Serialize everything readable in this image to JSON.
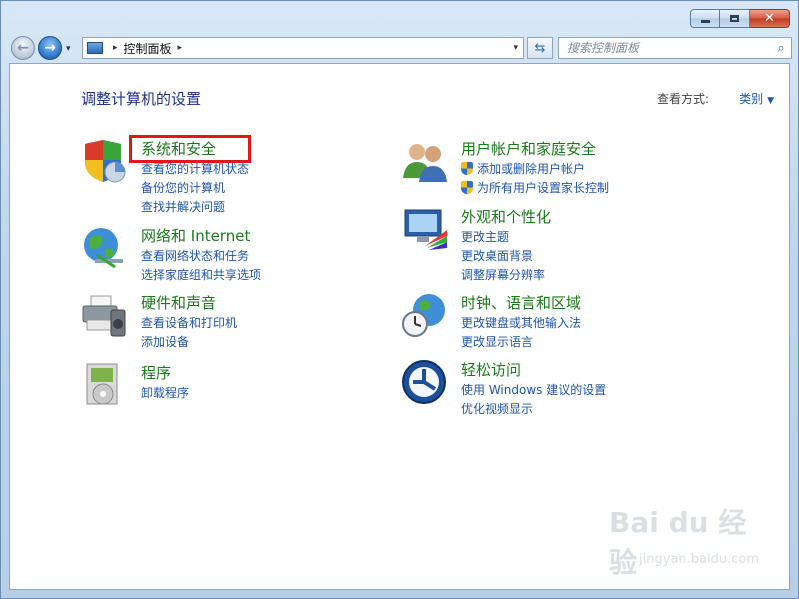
{
  "window": {
    "caption": {
      "minimize": "",
      "maximize": "",
      "close": "✕"
    }
  },
  "nav": {
    "back_icon": "←",
    "forward_icon": "→"
  },
  "address": {
    "separator_before": "▸",
    "path": "控制面板",
    "separator_after": "▸",
    "dropdown": "▾"
  },
  "search": {
    "placeholder": "搜索控制面板"
  },
  "header": {
    "title": "调整计算机的设置",
    "view_by_label": "查看方式:",
    "view_by_value": "类别"
  },
  "categories": {
    "left": [
      {
        "title": "系统和安全",
        "links": [
          "查看您的计算机状态",
          "备份您的计算机",
          "查找并解决问题"
        ]
      },
      {
        "title": "网络和 Internet",
        "links": [
          "查看网络状态和任务",
          "选择家庭组和共享选项"
        ]
      },
      {
        "title": "硬件和声音",
        "links": [
          "查看设备和打印机",
          "添加设备"
        ]
      },
      {
        "title": "程序",
        "links": [
          "卸载程序"
        ]
      }
    ],
    "right": [
      {
        "title": "用户帐户和家庭安全",
        "links": [
          "添加或删除用户帐户",
          "为所有用户设置家长控制"
        ]
      },
      {
        "title": "外观和个性化",
        "links": [
          "更改主题",
          "更改桌面背景",
          "调整屏幕分辨率"
        ]
      },
      {
        "title": "时钟、语言和区域",
        "links": [
          "更改键盘或其他输入法",
          "更改显示语言"
        ]
      },
      {
        "title": "轻松访问",
        "links": [
          "使用 Windows 建议的设置",
          "优化视频显示"
        ]
      }
    ]
  },
  "watermark": {
    "top": "Bai du 经验",
    "bottom": "jingyan.baidu.com"
  },
  "colors": {
    "category_title": "#1a7a1a",
    "link": "#1f56a8",
    "page_title": "#1e3287",
    "highlight": "#e2141c"
  }
}
